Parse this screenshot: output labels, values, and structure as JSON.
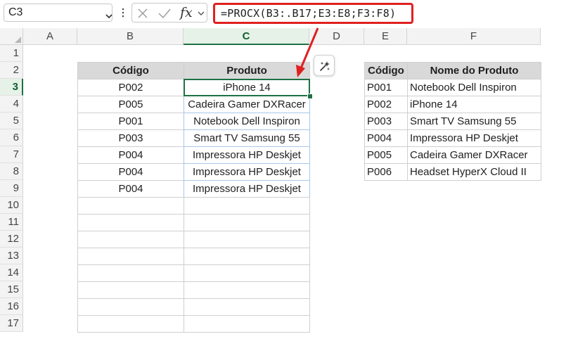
{
  "formula_bar": {
    "name_box": "C3",
    "fx_label": "fx",
    "formula": "=PROCX(B3:.B17;E3:E8;F3:F8)"
  },
  "columns": [
    "A",
    "B",
    "C",
    "D",
    "E",
    "F"
  ],
  "selected_column": "C",
  "rows": [
    "1",
    "2",
    "3",
    "4",
    "5",
    "6",
    "7",
    "8",
    "9",
    "10",
    "11",
    "12",
    "13",
    "14",
    "15",
    "16",
    "17"
  ],
  "selected_row": "3",
  "left_table": {
    "headers": [
      "Código",
      "Produto"
    ],
    "rows": [
      [
        "P002",
        "iPhone 14"
      ],
      [
        "P005",
        "Cadeira Gamer DXRacer"
      ],
      [
        "P001",
        "Notebook Dell Inspiron"
      ],
      [
        "P003",
        "Smart TV Samsung 55"
      ],
      [
        "P004",
        "Impressora HP Deskjet"
      ],
      [
        "P004",
        "Impressora HP Deskjet"
      ],
      [
        "P004",
        "Impressora HP Deskjet"
      ]
    ]
  },
  "right_table": {
    "headers": [
      "Código",
      "Nome do Produto"
    ],
    "rows": [
      [
        "P001",
        "Notebook Dell Inspiron"
      ],
      [
        "P002",
        "iPhone 14"
      ],
      [
        "P003",
        "Smart TV Samsung 55"
      ],
      [
        "P004",
        "Impressora HP Deskjet"
      ],
      [
        "P005",
        "Cadeira Gamer DXRacer"
      ],
      [
        "P006",
        "Headset HyperX Cloud II"
      ]
    ]
  },
  "colors": {
    "accent_green": "#1e7145",
    "highlight_red": "#e02020",
    "header_fill": "#d9d9d9",
    "spill_blue": "#a9c6e8"
  }
}
